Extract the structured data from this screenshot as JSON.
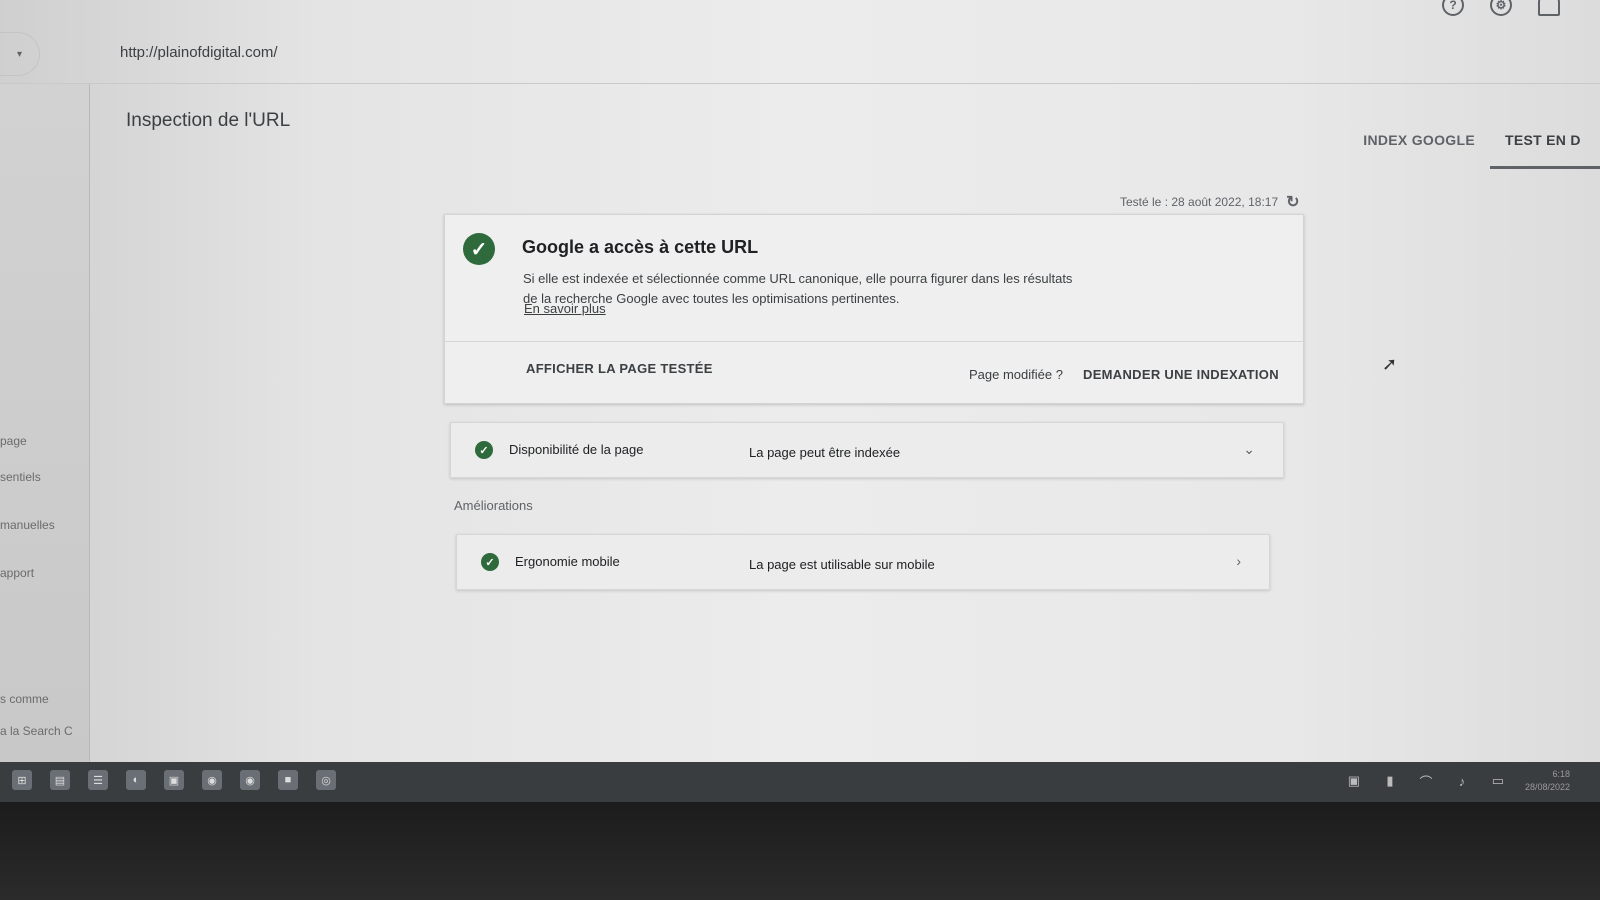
{
  "url_bar": {
    "url": "http://plainofdigital.com/",
    "dropdown_icon": "▾"
  },
  "page": {
    "title": "Inspection de l'URL"
  },
  "sidebar": {
    "items": [
      {
        "label": "page"
      },
      {
        "label": "sentiels"
      },
      {
        "label": "manuelles"
      },
      {
        "label": "apport"
      },
      {
        "label": "s comme"
      },
      {
        "label": "a la Search C"
      }
    ]
  },
  "tabs": [
    {
      "label": "INDEX GOOGLE"
    },
    {
      "label": "TEST EN D"
    }
  ],
  "tested": {
    "label": "Testé le : 28 août 2022, 18:17"
  },
  "main_card": {
    "title": "Google a accès à cette URL",
    "description": "Si elle est indexée et sélectionnée comme URL canonique, elle pourra figurer dans les résultats de la recherche Google avec toutes les optimisations pertinentes.",
    "learn_more": "En savoir plus",
    "view_tested_page": "AFFICHER LA PAGE TESTÉE",
    "modified_label": "Page modifiée ?",
    "request_indexing": "DEMANDER UNE INDEXATION"
  },
  "availability": {
    "label": "Disponibilité de la page",
    "value": "La page peut être indexée"
  },
  "improvements": {
    "section_label": "Améliorations",
    "mobile": {
      "label": "Ergonomie mobile",
      "value": "La page est utilisable sur mobile"
    }
  },
  "taskbar": {
    "clock_time": "6:18",
    "clock_date": "28/08/2022"
  },
  "colors": {
    "check_green": "#2e6a3c",
    "text": "#202124",
    "muted": "#5f6368"
  }
}
